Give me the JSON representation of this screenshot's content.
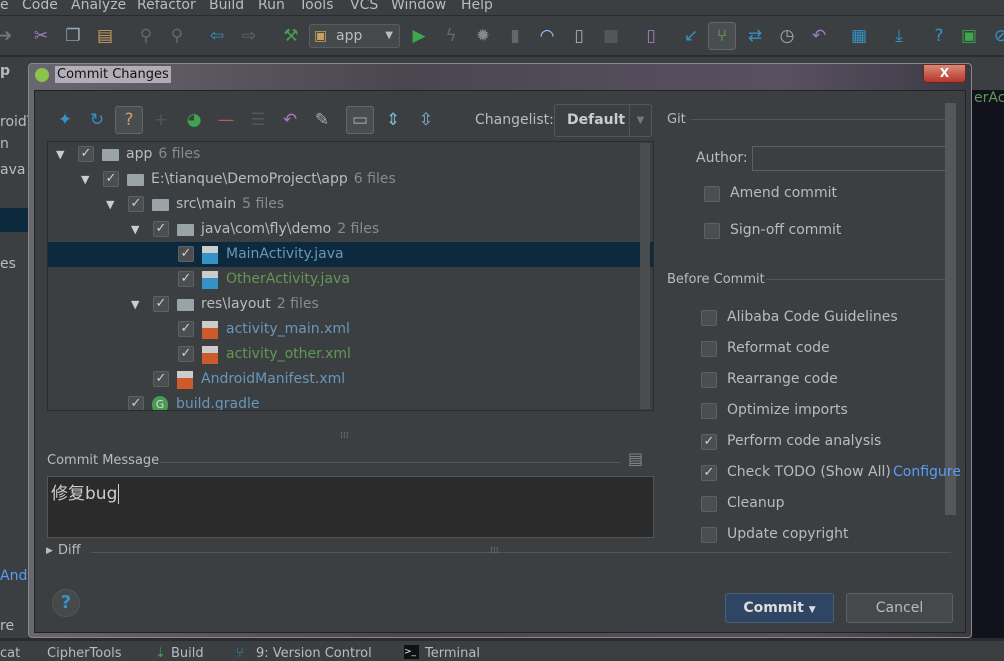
{
  "menu": [
    "e",
    "Code",
    "Analyze",
    "Refactor",
    "Build",
    "Run",
    "Tools",
    "VCS",
    "Window",
    "Help"
  ],
  "toolbar": {
    "run_config": "app",
    "icons": [
      "back-icon",
      "cut-icon",
      "copy-icon",
      "paste-icon",
      "find-icon",
      "replace-icon",
      "nav-back-icon",
      "nav-forward-icon",
      "build-hammer-icon",
      "run-icon",
      "apply-changes-icon",
      "debug-icon",
      "coverage-icon",
      "profile-icon",
      "attach-debugger-icon",
      "stop-icon",
      "avd-manager-icon",
      "vcs-update-icon",
      "vcs-commit-icon",
      "vcs-compare-icon",
      "history-icon",
      "revert-icon",
      "project-structure-icon",
      "sdk-manager-icon",
      "help-icon",
      "monitor-icon",
      "power-save-icon"
    ]
  },
  "navbar": {
    "crumb": "p",
    "right_tab": "erAc"
  },
  "left_strip": [
    "roidT",
    "n",
    "ava",
    "c",
    "",
    "",
    "es",
    "c",
    "c",
    "la",
    "",
    "",
    "n",
    "n",
    "n",
    "n",
    "n",
    "n",
    "v",
    "Andr",
    "",
    "re"
  ],
  "dialog": {
    "title": "Commit Changes",
    "close": "X",
    "changelist_label": "Changelist:",
    "changelist_value": "Default",
    "tree": [
      {
        "name": "app",
        "count": "6 files",
        "depth": 0,
        "expanded": true,
        "checked": true,
        "type": "module",
        "color": "#bbbbbb"
      },
      {
        "name": "E:\\tianque\\DemoProject\\app",
        "count": "6 files",
        "depth": 1,
        "expanded": true,
        "checked": true,
        "type": "folder",
        "color": "#bbbbbb"
      },
      {
        "name": "src\\main",
        "count": "5 files",
        "depth": 2,
        "expanded": true,
        "checked": true,
        "type": "folder",
        "color": "#bbbbbb"
      },
      {
        "name": "java\\com\\fly\\demo",
        "count": "2 files",
        "depth": 3,
        "expanded": true,
        "checked": true,
        "type": "folder",
        "color": "#bbbbbb"
      },
      {
        "name": "MainActivity.java",
        "count": "",
        "depth": 4,
        "checked": true,
        "type": "java",
        "color": "#6897bb",
        "selected": true
      },
      {
        "name": "OtherActivity.java",
        "count": "",
        "depth": 4,
        "checked": true,
        "type": "java",
        "color": "#629755"
      },
      {
        "name": "res\\layout",
        "count": "2 files",
        "depth": 3,
        "expanded": true,
        "checked": true,
        "type": "folder",
        "color": "#bbbbbb"
      },
      {
        "name": "activity_main.xml",
        "count": "",
        "depth": 4,
        "checked": true,
        "type": "xml",
        "color": "#6897bb"
      },
      {
        "name": "activity_other.xml",
        "count": "",
        "depth": 4,
        "checked": true,
        "type": "xml",
        "color": "#629755"
      },
      {
        "name": "AndroidManifest.xml",
        "count": "",
        "depth": 3,
        "checked": true,
        "type": "xml",
        "color": "#6897bb"
      },
      {
        "name": "build.gradle",
        "count": "",
        "depth": 2,
        "checked": true,
        "type": "gradle",
        "color": "#6897bb"
      }
    ],
    "commit_message_label": "Commit Message",
    "commit_message": "修复bug",
    "diff_label": "Diff",
    "git": {
      "section": "Git",
      "author_label": "Author:",
      "author_value": "",
      "amend": {
        "label": "Amend commit",
        "checked": false
      },
      "signoff": {
        "label": "Sign-off commit",
        "checked": false
      }
    },
    "before_commit": {
      "section": "Before Commit",
      "options": [
        {
          "label": "Alibaba Code Guidelines",
          "checked": false
        },
        {
          "label": "Reformat code",
          "checked": false
        },
        {
          "label": "Rearrange code",
          "checked": false
        },
        {
          "label": "Optimize imports",
          "checked": false
        },
        {
          "label": "Perform code analysis",
          "checked": true
        },
        {
          "label": "Check TODO (Show All)",
          "checked": true,
          "link": "Configure"
        },
        {
          "label": "Cleanup",
          "checked": false
        },
        {
          "label": "Update copyright",
          "checked": false
        }
      ]
    },
    "help": "?",
    "commit_button": "Commit",
    "cancel_button": "Cancel"
  },
  "statusbar": [
    "cat",
    "CipherTools",
    "Build",
    "9: Version Control",
    "Terminal"
  ],
  "colors": {
    "selection": "#0d293e",
    "link": "#589df6",
    "modified": "#6897bb",
    "added": "#629755",
    "commit_btn": "#2e4563"
  }
}
